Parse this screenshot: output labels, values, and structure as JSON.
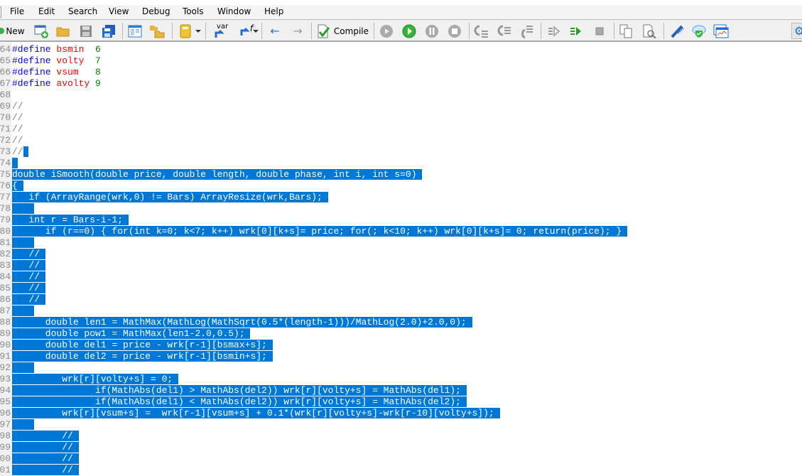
{
  "menu": [
    "File",
    "Edit",
    "Search",
    "View",
    "Debug",
    "Tools",
    "Window",
    "Help"
  ],
  "toolbar": {
    "new_label": "New",
    "compile_label": "Compile",
    "var_label": "var",
    "f_label": "f",
    "icons": [
      "new-icon",
      "new-project-icon",
      "open-folder-icon",
      "save-icon",
      "save-all-icon",
      "navigator-icon",
      "toolbox-folder-icon",
      "reference-book-icon",
      "insert-variable-icon",
      "insert-function-icon",
      "back-arrow-icon",
      "forward-arrow-icon",
      "compile-icon",
      "replay-icon",
      "start-debug-icon",
      "pause-icon",
      "stop-icon",
      "step-into-icon",
      "step-over-icon",
      "step-out-icon",
      "profile-icon",
      "start-profiling-icon",
      "stop-profiling-icon",
      "copy-icon",
      "find-icon",
      "styler-comb-icon",
      "cloud-shield-icon",
      "chart-window-icon",
      "settings-gear-icon"
    ]
  },
  "colors": {
    "selection": "#0078d7",
    "keyword": "#0000ff",
    "identifier": "#ff0000",
    "number": "#008000",
    "comment": "#808080"
  },
  "lines": [
    {
      "n": "64",
      "tokens": [
        [
          "kw",
          "#define"
        ],
        [
          "",
          ""
        ],
        [
          "nm",
          " bsmin"
        ],
        [
          "num",
          "  6"
        ]
      ]
    },
    {
      "n": "65",
      "tokens": [
        [
          "kw",
          "#define"
        ],
        [
          "nm",
          " volty"
        ],
        [
          "num",
          "  7"
        ]
      ]
    },
    {
      "n": "66",
      "tokens": [
        [
          "kw",
          "#define"
        ],
        [
          "nm",
          " vsum"
        ],
        [
          "num",
          "   8"
        ]
      ]
    },
    {
      "n": "67",
      "tokens": [
        [
          "kw",
          "#define"
        ],
        [
          "nm",
          " avolty"
        ],
        [
          "num",
          " 9"
        ]
      ]
    },
    {
      "n": "68",
      "plain": ""
    },
    {
      "n": "69",
      "comment": "//"
    },
    {
      "n": "70",
      "comment": "//"
    },
    {
      "n": "71",
      "comment": "//"
    },
    {
      "n": "72",
      "comment": "//"
    },
    {
      "n": "73",
      "comment": "//",
      "tail": " "
    },
    {
      "n": "74",
      "sel": " "
    },
    {
      "n": "75",
      "sel": "double iSmooth(double price, double length, double phase, int i, int s=0) "
    },
    {
      "n": "76",
      "sel": "{ "
    },
    {
      "n": "77",
      "sel": "   if (ArrayRange(wrk,0) != Bars) ArrayResize(wrk,Bars); "
    },
    {
      "n": "78",
      "sel": "    "
    },
    {
      "n": "79",
      "sel": "   int r = Bars-i-1; "
    },
    {
      "n": "80",
      "sel": "      if (r==0) { for(int k=0; k<7; k++) wrk[0][k+s]= price; for(; k<10; k++) wrk[0][k+s]= 0; return(price); } "
    },
    {
      "n": "81",
      "sel": "    "
    },
    {
      "n": "82",
      "sel": "   // "
    },
    {
      "n": "83",
      "sel": "   // "
    },
    {
      "n": "84",
      "sel": "   // "
    },
    {
      "n": "85",
      "sel": "   // "
    },
    {
      "n": "86",
      "sel": "   // "
    },
    {
      "n": "87",
      "sel": "    "
    },
    {
      "n": "88",
      "sel": "      double len1 = MathMax(MathLog(MathSqrt(0.5*(length-1)))/MathLog(2.0)+2.0,0); "
    },
    {
      "n": "89",
      "sel": "      double pow1 = MathMax(len1-2.0,0.5); "
    },
    {
      "n": "90",
      "sel": "      double del1 = price - wrk[r-1][bsmax+s]; "
    },
    {
      "n": "91",
      "sel": "      double del2 = price - wrk[r-1][bsmin+s]; "
    },
    {
      "n": "92",
      "sel": "    "
    },
    {
      "n": "93",
      "sel": "         wrk[r][volty+s] = 0; "
    },
    {
      "n": "94",
      "sel": "               if(MathAbs(del1) > MathAbs(del2)) wrk[r][volty+s] = MathAbs(del1); "
    },
    {
      "n": "95",
      "sel": "               if(MathAbs(del1) < MathAbs(del2)) wrk[r][volty+s] = MathAbs(del2); "
    },
    {
      "n": "96",
      "sel": "         wrk[r][vsum+s] =  wrk[r-1][vsum+s] + 0.1*(wrk[r][volty+s]-wrk[r-10][volty+s]); "
    },
    {
      "n": "97",
      "sel": "    "
    },
    {
      "n": "98",
      "sel": "         // "
    },
    {
      "n": "99",
      "sel": "         // "
    },
    {
      "n": "100",
      "sel": "         // "
    },
    {
      "n": "101",
      "sel": "         // "
    }
  ]
}
